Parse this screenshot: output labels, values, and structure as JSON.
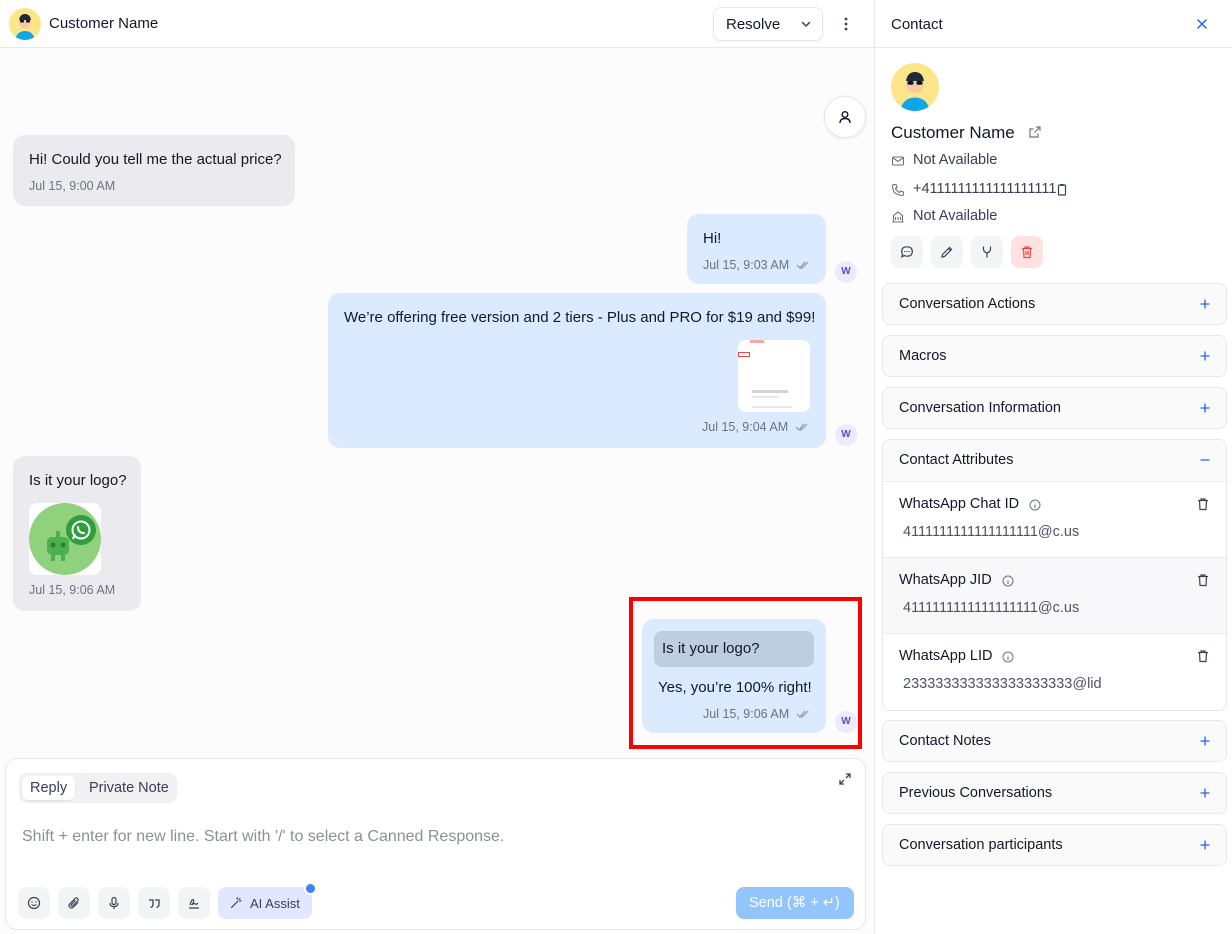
{
  "header": {
    "customer_name": "Customer Name",
    "resolve_label": "Resolve"
  },
  "messages": [
    {
      "direction": "incoming",
      "text": "Hi! Could you tell me the actual price?",
      "time": "Jul 15, 9:00 AM"
    },
    {
      "direction": "outgoing",
      "text": "Hi!",
      "time": "Jul 15, 9:03 AM",
      "sender_initial": "W"
    },
    {
      "direction": "outgoing",
      "text": "We’re offering free version and 2 tiers - Plus and PRO for $19 and $99!",
      "time": "Jul 15, 9:04 AM",
      "sender_initial": "W",
      "attachment": "image"
    },
    {
      "direction": "incoming",
      "text": "Is it your logo?",
      "time": "Jul 15, 9:06 AM",
      "attachment": "image"
    },
    {
      "direction": "outgoing",
      "quoted": "Is it your logo?",
      "text": "Yes, you’re 100% right!",
      "time": "Jul 15, 9:06 AM",
      "sender_initial": "W"
    }
  ],
  "composer": {
    "tabs": [
      "Reply",
      "Private Note"
    ],
    "active_tab": "Reply",
    "placeholder": "Shift + enter for new line. Start with '/' to select a Canned Response.",
    "ai_assist_label": "AI Assist",
    "send_label": "Send (⌘ + ↵)",
    "tool_icons": [
      "emoji-icon",
      "attachment-icon",
      "microphone-icon",
      "quote-icon",
      "signature-icon"
    ]
  },
  "contact_panel": {
    "title": "Contact",
    "name": "Customer Name",
    "email": "Not Available",
    "phone": "+4111111111111111111",
    "company": "Not Available",
    "actions": [
      "message-icon",
      "edit-icon",
      "merge-icon",
      "delete-icon"
    ],
    "sections": [
      {
        "title": "Conversation Actions",
        "expanded": false
      },
      {
        "title": "Macros",
        "expanded": false
      },
      {
        "title": "Conversation Information",
        "expanded": false
      },
      {
        "title": "Contact Attributes",
        "expanded": true
      },
      {
        "title": "Contact Notes",
        "expanded": false
      },
      {
        "title": "Previous Conversations",
        "expanded": false
      },
      {
        "title": "Conversation participants",
        "expanded": false
      }
    ],
    "attributes": [
      {
        "name": "WhatsApp Chat ID",
        "value": "4111111111111111111@c.us"
      },
      {
        "name": "WhatsApp JID",
        "value": "4111111111111111111@c.us"
      },
      {
        "name": "WhatsApp LID",
        "value": "233333333333333333333@lid"
      }
    ]
  },
  "colors": {
    "outgoing_bubble": "#dbeafe",
    "incoming_bubble": "#ebebef",
    "send_button": "#93c5fd",
    "highlight": "#ff0000"
  }
}
